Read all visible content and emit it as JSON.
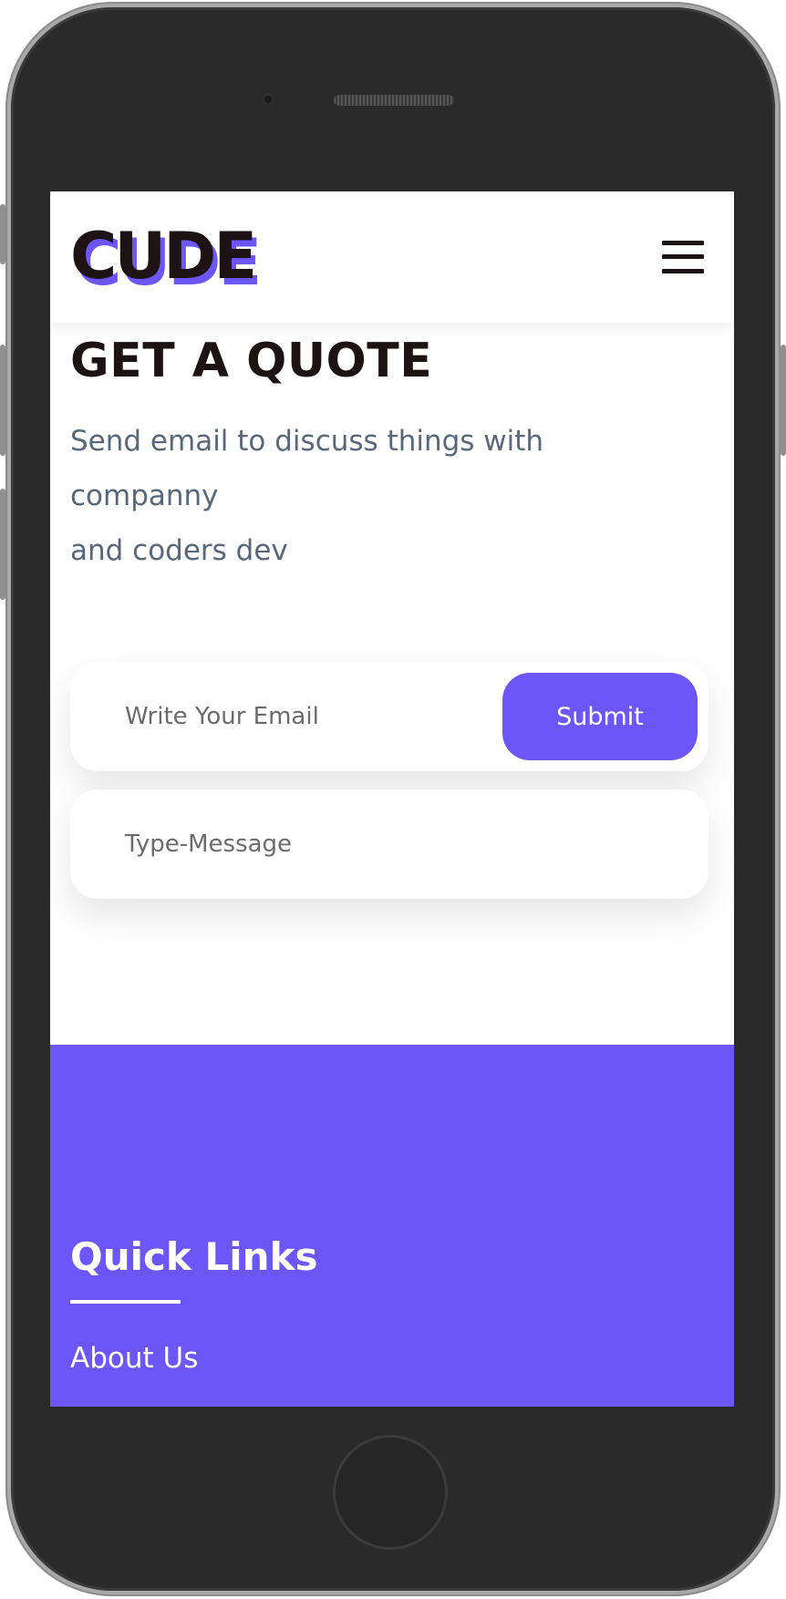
{
  "header": {
    "logo_text": "CUDE",
    "menu_icon": "hamburger-menu-icon"
  },
  "quote": {
    "title": "GET A QUOTE",
    "description_lines": [
      "Send email to discuss things with",
      "companny",
      "and coders dev"
    ]
  },
  "form": {
    "email_placeholder": "Write Your Email",
    "email_value": "",
    "submit_label": "Submit",
    "message_placeholder": "Type-Message",
    "message_value": ""
  },
  "footer": {
    "title": "Quick Links",
    "links": [
      "About Us"
    ]
  },
  "colors": {
    "accent": "#6c56f7",
    "dark_text": "#1d1214",
    "muted_text": "#58677a",
    "device_body": "#2a2a2a",
    "device_frame": "#a9a9a9"
  }
}
